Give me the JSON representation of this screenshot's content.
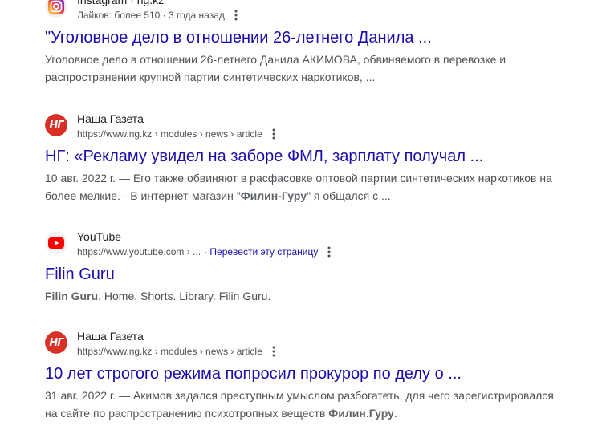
{
  "results": [
    {
      "source": "Instagram · ng.kz_",
      "meta": "Лайков: более 510 · 3 года назад",
      "title": "\"Уголовное дело в отношении 26-летнего Данила ...",
      "snippet_line1": "Уголовное дело в отношении 26-летнего Данила АКИМОВА, обвиняемого в перевозке и",
      "snippet_line2": "распространении крупной партии синтетических наркотиков, ..."
    },
    {
      "source": "Наша Газета",
      "favicon_text": "НГ",
      "url": "https://www.ng.kz › modules › news › article",
      "title": "НГ: «Рекламу увидел на заборе ФМЛ, зарплату получал ...",
      "snippet_a": "10 авг. 2022 г. — Его также обвиняют в расфасовке оптовой партии синтетических наркотиков на",
      "snippet_b": "более мелкие. - В интернет-магазин \"",
      "snippet_bold": "Филин-Гуру",
      "snippet_c": "\" я общался с ..."
    },
    {
      "source": "YouTube",
      "url": "https://www.youtube.com › ...",
      "translate": "· Перевести эту страницу",
      "title": "Filin Guru",
      "snippet_bold": "Filin Guru",
      "snippet_rest": ". Home. Shorts. Library. Filin Guru."
    },
    {
      "source": "Наша Газета",
      "favicon_text": "НГ",
      "url": "https://www.ng.kz › modules › news › article",
      "title": "10 лет строгого режима попросил прокурор по делу о ...",
      "snippet_a": "31 авг. 2022 г. — Акимов задался преступным умыслом разбогатеть, для чего зарегистрировался",
      "snippet_b": "на сайте по распространению психотропных веществ ",
      "snippet_bold": "Филин",
      "snippet_dot": ".",
      "snippet_bold2": "Гуру",
      "snippet_end": "."
    }
  ],
  "colors": {
    "link": "#1a0dab",
    "text": "#4d5156",
    "ng_red": "#d93025",
    "youtube_red": "#ff0000"
  },
  "icons": [
    "instagram-icon",
    "ng-logo-icon",
    "youtube-icon",
    "more-vert-icon"
  ]
}
